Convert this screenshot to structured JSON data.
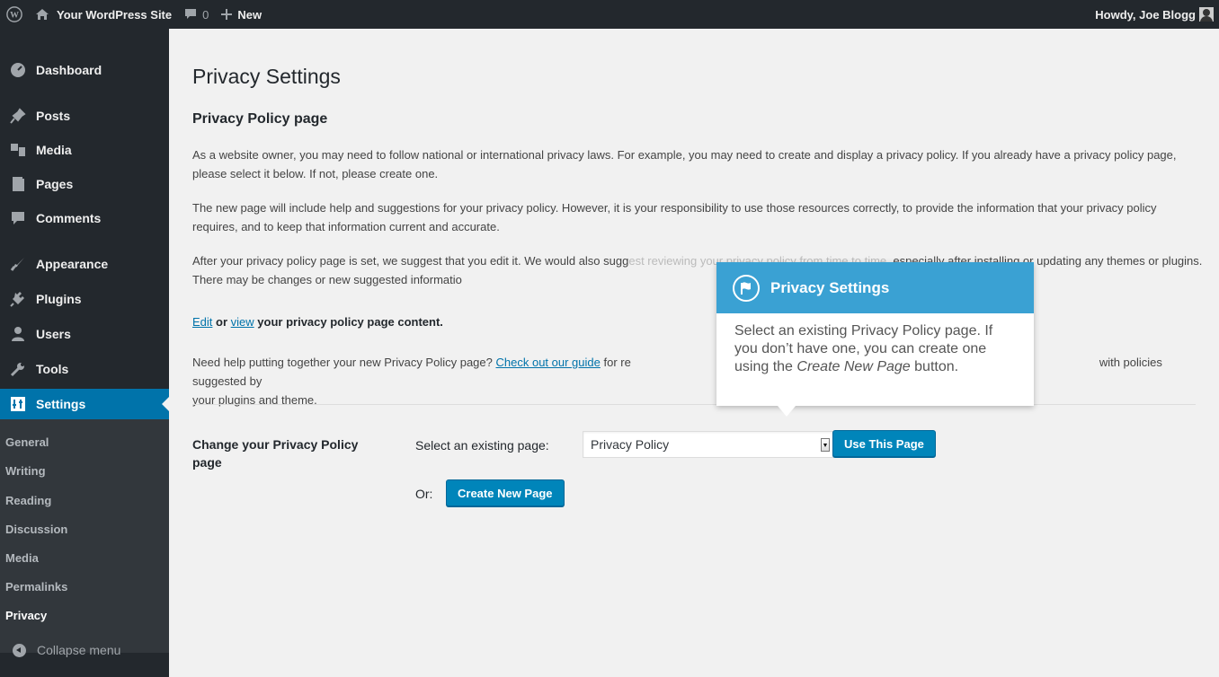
{
  "adminbar": {
    "site_name": "Your WordPress Site",
    "comment_count": "0",
    "new_label": "New",
    "howdy": "Howdy, Joe Blogg"
  },
  "sidebar": {
    "items": [
      {
        "label": "Dashboard",
        "icon": "dashboard-icon"
      },
      {
        "label": "Posts",
        "icon": "pin-icon"
      },
      {
        "label": "Media",
        "icon": "media-icon"
      },
      {
        "label": "Pages",
        "icon": "pages-icon"
      },
      {
        "label": "Comments",
        "icon": "comment-icon"
      },
      {
        "label": "Appearance",
        "icon": "brush-icon"
      },
      {
        "label": "Plugins",
        "icon": "plug-icon"
      },
      {
        "label": "Users",
        "icon": "user-icon"
      },
      {
        "label": "Tools",
        "icon": "wrench-icon"
      },
      {
        "label": "Settings",
        "icon": "settings-icon"
      }
    ],
    "submenu": [
      "General",
      "Writing",
      "Reading",
      "Discussion",
      "Media",
      "Permalinks",
      "Privacy"
    ],
    "collapse_label": "Collapse menu"
  },
  "main": {
    "title": "Privacy Settings",
    "section_title": "Privacy Policy page",
    "p1": "As a website owner, you may need to follow national or international privacy laws. For example, you may need to create and display a privacy policy. If you already have a privacy policy page, please select it below. If not, please create one.",
    "p2": "The new page will include help and suggestions for your privacy policy. However, it is your responsibility to use those resources correctly, to provide the information that your privacy policy requires, and to keep that information current and accurate.",
    "p3a": "After your privacy policy page is set, we suggest that you edit it. We would also sugg",
    "p3b": "especially after installing or updating any themes or plugins. There may be changes or new suggested informatio",
    "p3_faint": "est reviewing your privacy policy from time to time,",
    "edit_link": "Edit",
    "or_word": "or",
    "view_link": "view",
    "edit_rest": "your privacy policy page content.",
    "help_a": "Need help putting together your new Privacy Policy page?",
    "guide_link": "Check out our guide",
    "help_b": "for re",
    "help_c": "with policies suggested by",
    "help_d": "your plugins and theme.",
    "form_label": "Change your Privacy Policy page",
    "select_label": "Select an existing page:",
    "select_value": "Privacy Policy",
    "use_button": "Use This Page",
    "or_label": "Or:",
    "create_button": "Create New Page"
  },
  "pointer": {
    "title": "Privacy Settings",
    "body_a": "Select an existing Privacy Policy page. If you don’t have one, you can create one using the",
    "body_em": "Create New Page",
    "body_b": "button."
  },
  "colors": {
    "adminbar": "#23282d",
    "accent": "#0073aa",
    "button": "#0085ba",
    "pointer_header": "#3aa1d3"
  }
}
